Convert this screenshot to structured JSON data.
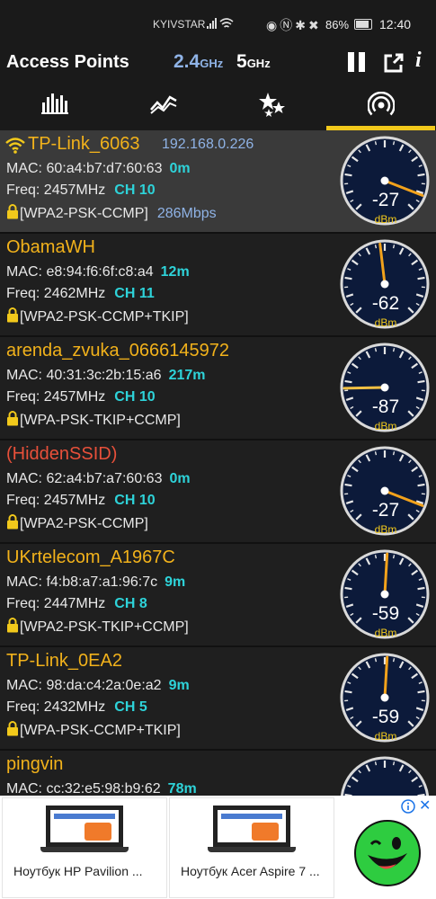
{
  "status_bar": {
    "carrier": "KYIVSTAR",
    "battery": "86%",
    "time": "12:40"
  },
  "app_bar": {
    "title": "Access Points",
    "band1": "2.4",
    "band1_unit": "GHz",
    "band2": "5",
    "band2_unit": "GHz",
    "info": "i"
  },
  "tabs": {
    "icons": [
      "bar-chart-icon",
      "time-graph-icon",
      "stars-icon",
      "access-point-icon"
    ],
    "selected_index": 3
  },
  "access_points": [
    {
      "ssid": "TP-Link_6063",
      "ip": "192.168.0.226",
      "mac_label": "MAC:",
      "mac": "60:a4:b7:d7:60:63",
      "distance": "0m",
      "freq_label": "Freq:",
      "freq": "2457MHz",
      "channel": "CH 10",
      "security": "[WPA2-PSK-CCMP]",
      "rate": "286Mbps",
      "dbm": "-27",
      "connected": true
    },
    {
      "ssid": "ObamaWH",
      "mac_label": "MAC:",
      "mac": "e8:94:f6:6f:c8:a4",
      "distance": "12m",
      "freq_label": "Freq:",
      "freq": "2462MHz",
      "channel": "CH 11",
      "security": "[WPA2-PSK-CCMP+TKIP]",
      "dbm": "-62"
    },
    {
      "ssid": "arenda_zvuka_0666145972",
      "mac_label": "MAC:",
      "mac": "40:31:3c:2b:15:a6",
      "distance": "217m",
      "freq_label": "Freq:",
      "freq": "2457MHz",
      "channel": "CH 10",
      "security": "[WPA-PSK-TKIP+CCMP]",
      "dbm": "-87"
    },
    {
      "ssid": "(HiddenSSID)",
      "mac_label": "MAC:",
      "mac": "62:a4:b7:a7:60:63",
      "distance": "0m",
      "freq_label": "Freq:",
      "freq": "2457MHz",
      "channel": "CH 10",
      "security": "[WPA2-PSK-CCMP]",
      "dbm": "-27",
      "hidden": true
    },
    {
      "ssid": "UKrtelecom_A1967C",
      "mac_label": "MAC:",
      "mac": "f4:b8:a7:a1:96:7c",
      "distance": "9m",
      "freq_label": "Freq:",
      "freq": "2447MHz",
      "channel": "CH 8",
      "security": "[WPA2-PSK-TKIP+CCMP]",
      "dbm": "-59"
    },
    {
      "ssid": "TP-Link_0EA2",
      "mac_label": "MAC:",
      "mac": "98:da:c4:2a:0e:a2",
      "distance": "9m",
      "freq_label": "Freq:",
      "freq": "2432MHz",
      "channel": "CH 5",
      "security": "[WPA-PSK-CCMP+TKIP]",
      "dbm": "-59"
    },
    {
      "ssid": "pingvin",
      "mac_label": "MAC:",
      "mac": "cc:32:e5:98:b9:62",
      "distance": "78m",
      "dbm": ""
    }
  ],
  "gauge_unit": "dBm",
  "ad": {
    "card1": "Ноутбук HP Pavilion ...",
    "card2": "Ноутбук Acer Aspire 7 ...",
    "close": "✕"
  },
  "colors": {
    "ssid": "#f2b21b",
    "hidden_ssid": "#e8503a",
    "accent_cyan": "#2ed3d9",
    "accent_blue": "#8fb3e6",
    "tab_indicator": "#f2c91b",
    "gauge_needle_strong": "#f2a21b",
    "gauge_needle_weak": "#f2c043"
  }
}
